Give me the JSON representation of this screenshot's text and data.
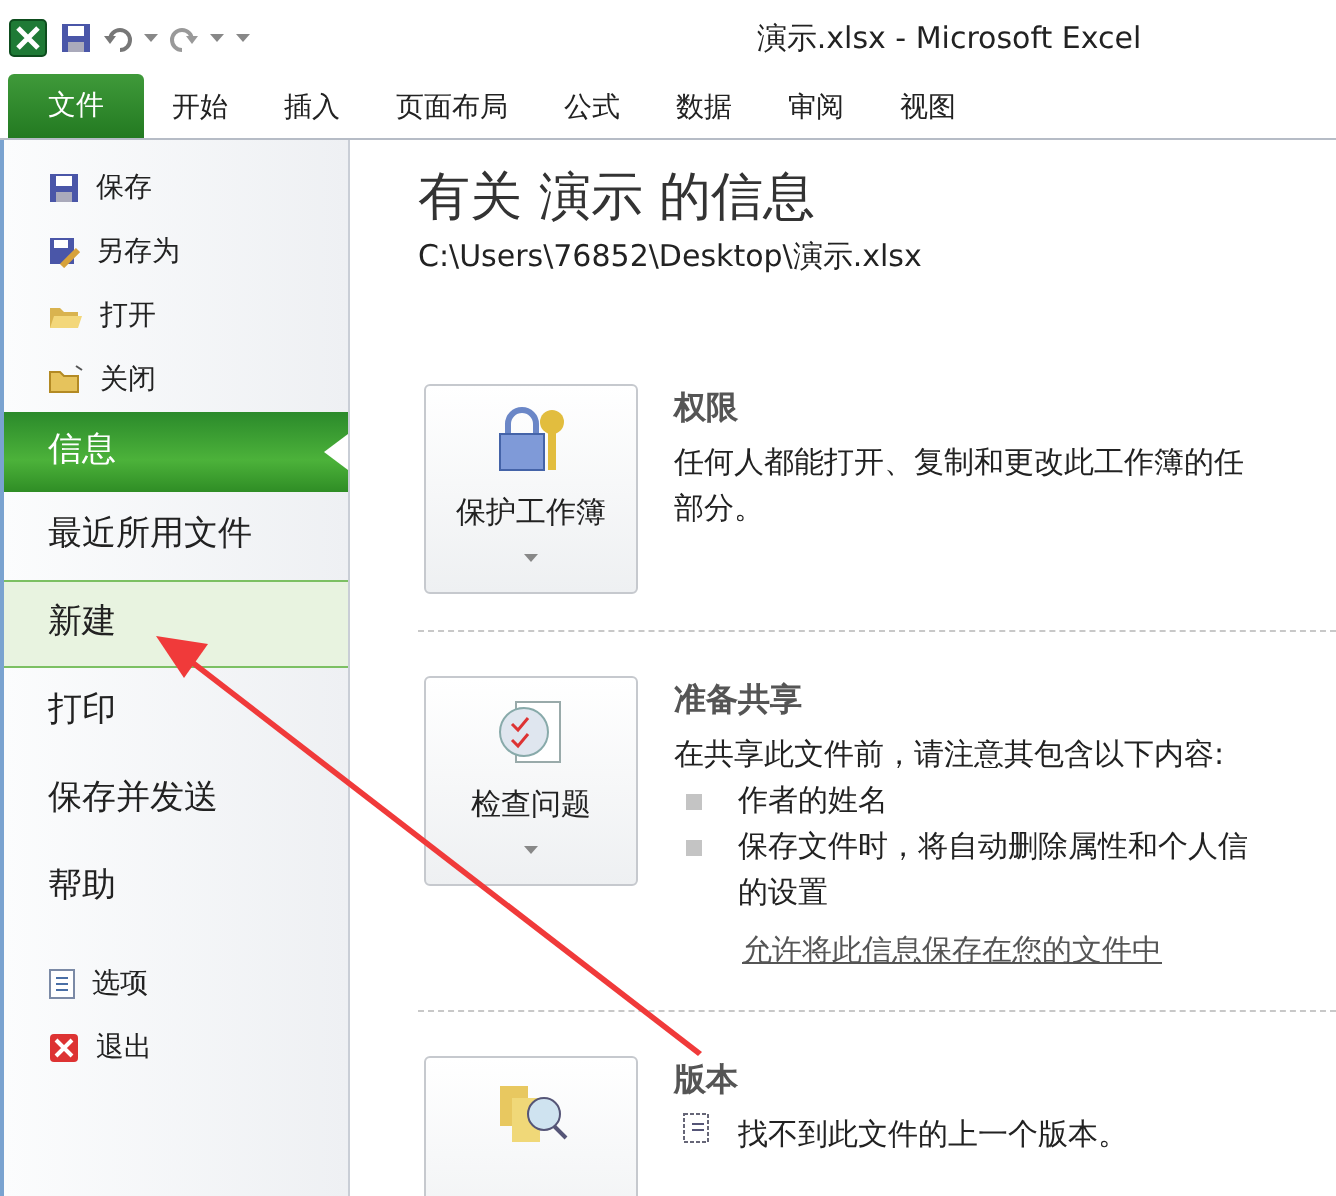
{
  "window": {
    "title": "演示.xlsx - Microsoft Excel"
  },
  "ribbon_tabs": [
    {
      "label": "文件",
      "selected": true
    },
    {
      "label": "开始",
      "selected": false
    },
    {
      "label": "插入",
      "selected": false
    },
    {
      "label": "页面布局",
      "selected": false
    },
    {
      "label": "公式",
      "selected": false
    },
    {
      "label": "数据",
      "selected": false
    },
    {
      "label": "审阅",
      "selected": false
    },
    {
      "label": "视图",
      "selected": false
    }
  ],
  "sidebar": {
    "items": [
      {
        "kind": "command",
        "label": "保存"
      },
      {
        "kind": "command",
        "label": "另存为"
      },
      {
        "kind": "command",
        "label": "打开"
      },
      {
        "kind": "command",
        "label": "关闭"
      },
      {
        "kind": "tab",
        "label": "信息",
        "selected": true,
        "hovered": false
      },
      {
        "kind": "tab",
        "label": "最近所用文件",
        "selected": false,
        "hovered": false
      },
      {
        "kind": "tab",
        "label": "新建",
        "selected": false,
        "hovered": true
      },
      {
        "kind": "tab",
        "label": "打印",
        "selected": false,
        "hovered": false
      },
      {
        "kind": "tab",
        "label": "保存并发送",
        "selected": false,
        "hovered": false
      },
      {
        "kind": "tab",
        "label": "帮助",
        "selected": false,
        "hovered": false
      },
      {
        "kind": "command",
        "label": "选项"
      },
      {
        "kind": "command",
        "label": "退出"
      }
    ]
  },
  "info": {
    "title": "有关 演示 的信息",
    "path": "C:\\Users\\76852\\Desktop\\演示.xlsx",
    "sections": [
      {
        "button": "保护工作簿",
        "heading": "权限",
        "lines": [
          "任何人都能打开、复制和更改此工作簿的任",
          "部分。"
        ]
      },
      {
        "button": "检查问题",
        "heading": "准备共享",
        "lines": [
          "在共享此文件前，请注意其包含以下内容:"
        ],
        "bullets": [
          {
            "lines": [
              "作者的姓名"
            ]
          },
          {
            "lines": [
              "保存文件时，将自动删除属性和个人信",
              "的设置"
            ]
          }
        ],
        "link": "允许将此信息保存在您的文件中"
      },
      {
        "heading": "版本",
        "note": "找不到此文件的上一个版本。"
      }
    ]
  }
}
